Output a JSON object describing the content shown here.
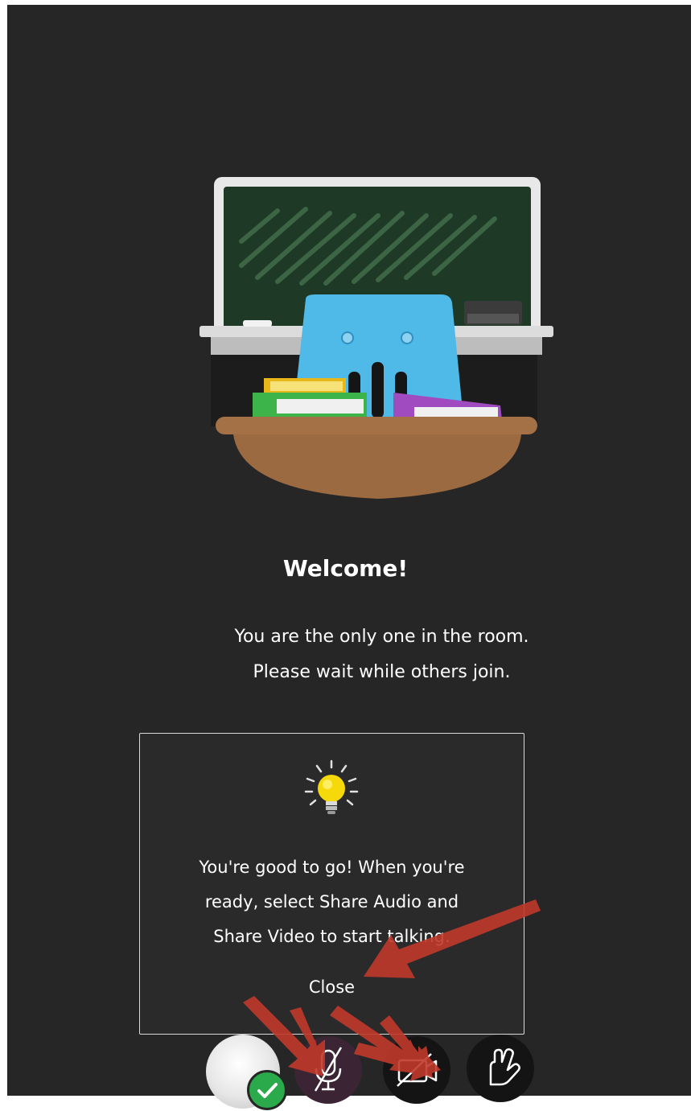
{
  "welcome": {
    "title": "Welcome!",
    "line1": "You are the only one in the room.",
    "line2": "Please wait while others join."
  },
  "tip": {
    "icon": "lightbulb-icon",
    "line1": "You're good to go! When you're",
    "line2": "ready, select Share Audio and",
    "line3": "Share Video to start talking.",
    "close_label": "Close"
  },
  "toolbar": {
    "avatar_status_icon": "check-icon",
    "audio_icon": "microphone-off-icon",
    "video_icon": "camera-off-icon",
    "raise_hand_icon": "raise-hand-icon"
  },
  "colors": {
    "background": "#262626",
    "chalkboard": "#1e3a26",
    "seat": "#4fb9e8",
    "desk": "#9c6a40",
    "annotation_arrow": "#c0392b",
    "status_green": "#2aaa4a"
  }
}
